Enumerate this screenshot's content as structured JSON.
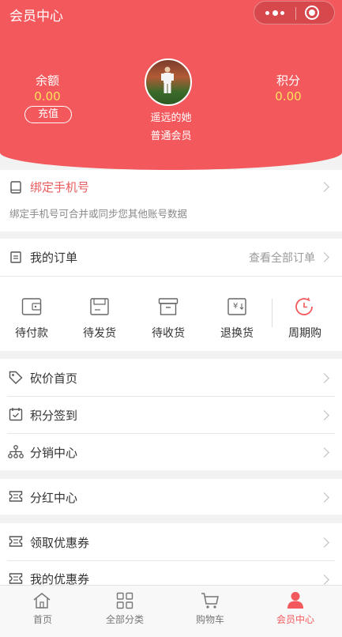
{
  "header": {
    "title": "会员中心",
    "balance_label": "余额",
    "balance_value": "0.00",
    "recharge_label": "充值",
    "points_label": "积分",
    "points_value": "0.00",
    "username": "遥远的她",
    "member_level": "普通会员",
    "colors": {
      "background": "#f3595c",
      "value": "#ffe15b"
    }
  },
  "bind_phone": {
    "title": "绑定手机号",
    "description": "绑定手机号可合并或同步您其他账号数据",
    "icon": "phone-icon",
    "title_color": "#e85a5c"
  },
  "orders": {
    "title": "我的订单",
    "view_all": "查看全部订单",
    "items": [
      {
        "label": "待付款",
        "icon": "wallet-icon"
      },
      {
        "label": "待发货",
        "icon": "box-icon"
      },
      {
        "label": "待收货",
        "icon": "package-icon"
      },
      {
        "label": "退换货",
        "icon": "refund-icon"
      },
      {
        "label": "周期购",
        "icon": "clock-icon"
      }
    ]
  },
  "menu_group1": [
    {
      "label": "砍价首页",
      "icon": "tag-icon"
    },
    {
      "label": "积分签到",
      "icon": "calendar-icon"
    },
    {
      "label": "分销中心",
      "icon": "hierarchy-icon"
    }
  ],
  "menu_group2": [
    {
      "label": "分红中心",
      "icon": "ticket-icon"
    }
  ],
  "menu_group3": [
    {
      "label": "领取优惠券",
      "icon": "coupon-icon"
    },
    {
      "label": "我的优惠券",
      "icon": "coupon-icon"
    }
  ],
  "tabbar": {
    "active_color": "#f3595c",
    "items": [
      {
        "label": "首页",
        "icon": "home-icon"
      },
      {
        "label": "全部分类",
        "icon": "grid-icon"
      },
      {
        "label": "购物车",
        "icon": "cart-icon"
      },
      {
        "label": "会员中心",
        "icon": "person-icon"
      }
    ]
  }
}
